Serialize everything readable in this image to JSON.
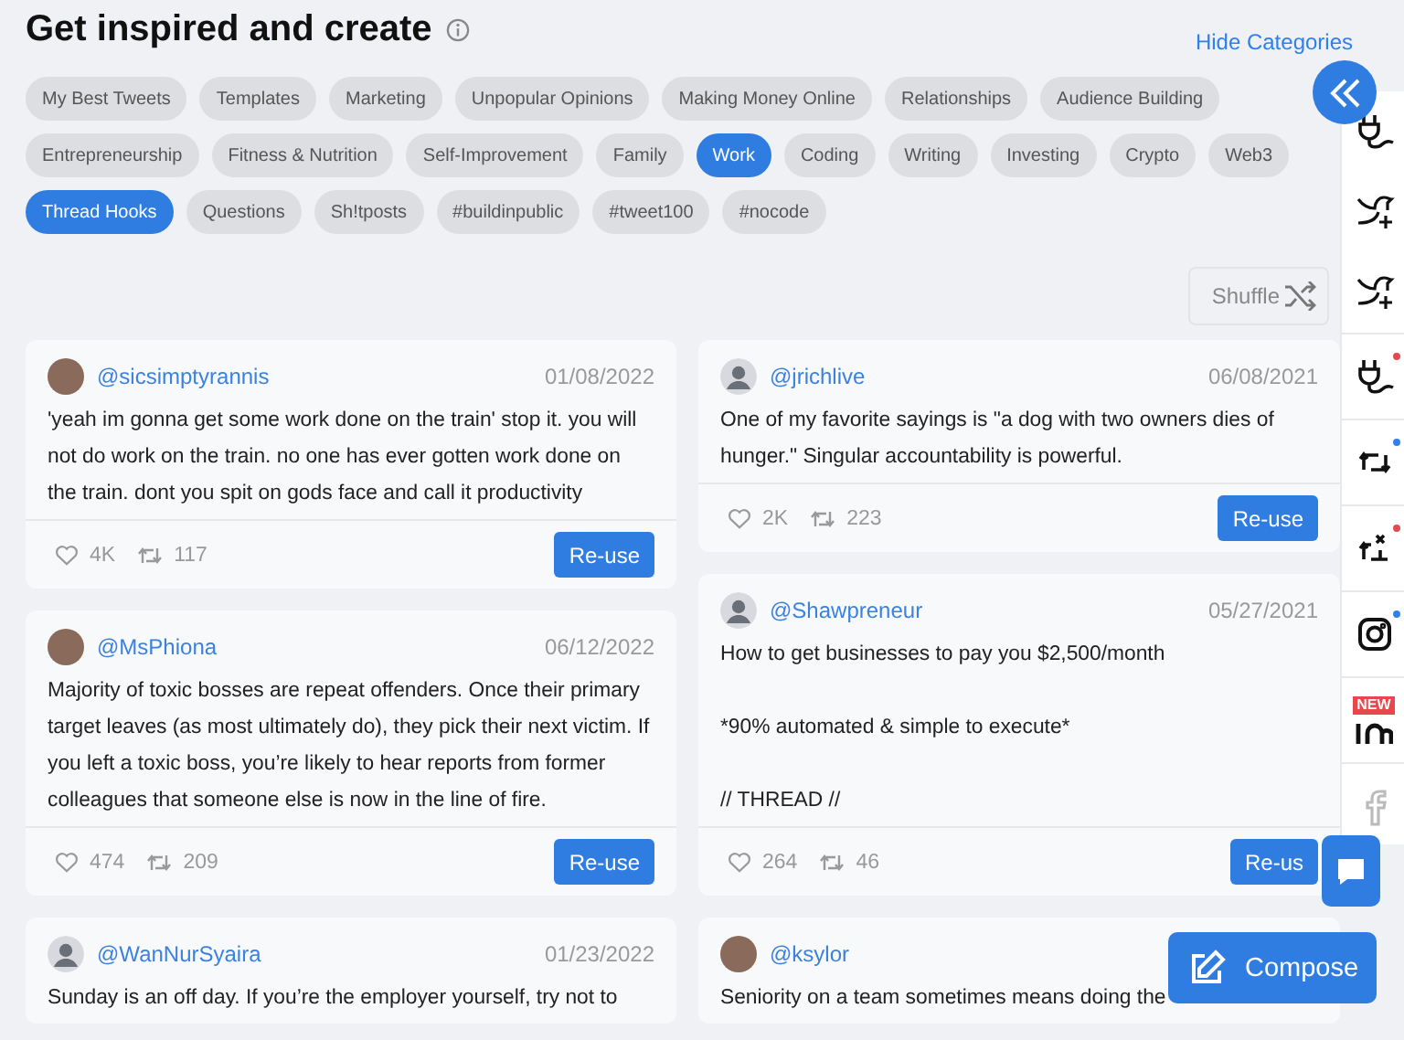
{
  "header": {
    "title": "Get inspired and create",
    "hide_link": "Hide Categories"
  },
  "categories": [
    {
      "label": "My Best Tweets",
      "selected": false
    },
    {
      "label": "Templates",
      "selected": false
    },
    {
      "label": "Marketing",
      "selected": false
    },
    {
      "label": "Unpopular Opinions",
      "selected": false
    },
    {
      "label": "Making Money Online",
      "selected": false
    },
    {
      "label": "Relationships",
      "selected": false
    },
    {
      "label": "Audience Building",
      "selected": false
    },
    {
      "label": "Entrepreneurship",
      "selected": false
    },
    {
      "label": "Fitness & Nutrition",
      "selected": false
    },
    {
      "label": "Self-Improvement",
      "selected": false
    },
    {
      "label": "Family",
      "selected": false
    },
    {
      "label": "Work",
      "selected": true
    },
    {
      "label": "Coding",
      "selected": false
    },
    {
      "label": "Writing",
      "selected": false
    },
    {
      "label": "Investing",
      "selected": false
    },
    {
      "label": "Crypto",
      "selected": false
    },
    {
      "label": "Web3",
      "selected": false
    },
    {
      "label": "Thread Hooks",
      "selected": true
    },
    {
      "label": "Questions",
      "selected": false
    },
    {
      "label": "Sh!tposts",
      "selected": false
    },
    {
      "label": "#buildinpublic",
      "selected": false
    },
    {
      "label": "#tweet100",
      "selected": false
    },
    {
      "label": "#nocode",
      "selected": false
    }
  ],
  "shuffle_button": "Shuffle",
  "columns": [
    [
      {
        "handle": "@sicsimptyrannis",
        "date": "01/08/2022",
        "avatar": {
          "kind": "photo"
        },
        "text": [
          "'yeah im gonna get some work done on the train' stop it. you will not do work on the train. no one has ever gotten work done on the train. dont you spit on gods face and call it productivity"
        ],
        "likes": "4K",
        "retweets": "117",
        "button": "Re-use"
      },
      {
        "handle": "@MsPhiona",
        "date": "06/12/2022",
        "avatar": {
          "kind": "photo"
        },
        "text": [
          "Majority of toxic bosses are repeat offenders. Once their primary target leaves (as most ultimately do), they pick their next victim. If you left a toxic boss, you’re likely to hear reports from former colleagues that someone else is now in the line of fire."
        ],
        "likes": "474",
        "retweets": "209",
        "button": "Re-use"
      },
      {
        "handle": "@WanNurSyaira",
        "date": "01/23/2022",
        "avatar": {
          "kind": "default"
        },
        "text": [
          "Sunday is an off day. If you’re the employer yourself, try not to"
        ]
      }
    ],
    [
      {
        "handle": "@jrichlive",
        "date": "06/08/2021",
        "avatar": {
          "kind": "default"
        },
        "text": [
          "One of my favorite sayings is \"a dog with two owners dies of hunger.\" Singular accountability is powerful."
        ],
        "likes": "2K",
        "retweets": "223",
        "button": "Re-use"
      },
      {
        "handle": "@Shawpreneur",
        "date": "05/27/2021",
        "avatar": {
          "kind": "default"
        },
        "text": [
          "How to get businesses to pay you $2,500/month",
          "*90% automated & simple to execute*",
          "// THREAD //"
        ],
        "likes": "264",
        "retweets": "46",
        "button": "Re-us"
      },
      {
        "handle": "@ksylor",
        "avatar": {
          "kind": "photo"
        },
        "text": [
          "Seniority on a team sometimes means doing the"
        ]
      }
    ]
  ],
  "sidebar": [
    {
      "kind": "plug",
      "disabled": false
    },
    {
      "kind": "bird-plus",
      "disabled": false
    },
    {
      "kind": "bird-plus",
      "disabled": false
    },
    {
      "kind": "plug",
      "disabled": false,
      "color": "#e5484d"
    },
    {
      "kind": "retweet",
      "disabled": false,
      "color": "#2f80ed"
    },
    {
      "kind": "retweet-x",
      "disabled": false,
      "color": "#e5484d"
    },
    {
      "kind": "instagram",
      "disabled": false,
      "color": "#2f80ed"
    },
    {
      "kind": "in-logo",
      "disabled": false,
      "badge": "NEW"
    },
    {
      "kind": "facebook",
      "disabled": true
    }
  ],
  "compose_button": "Compose"
}
